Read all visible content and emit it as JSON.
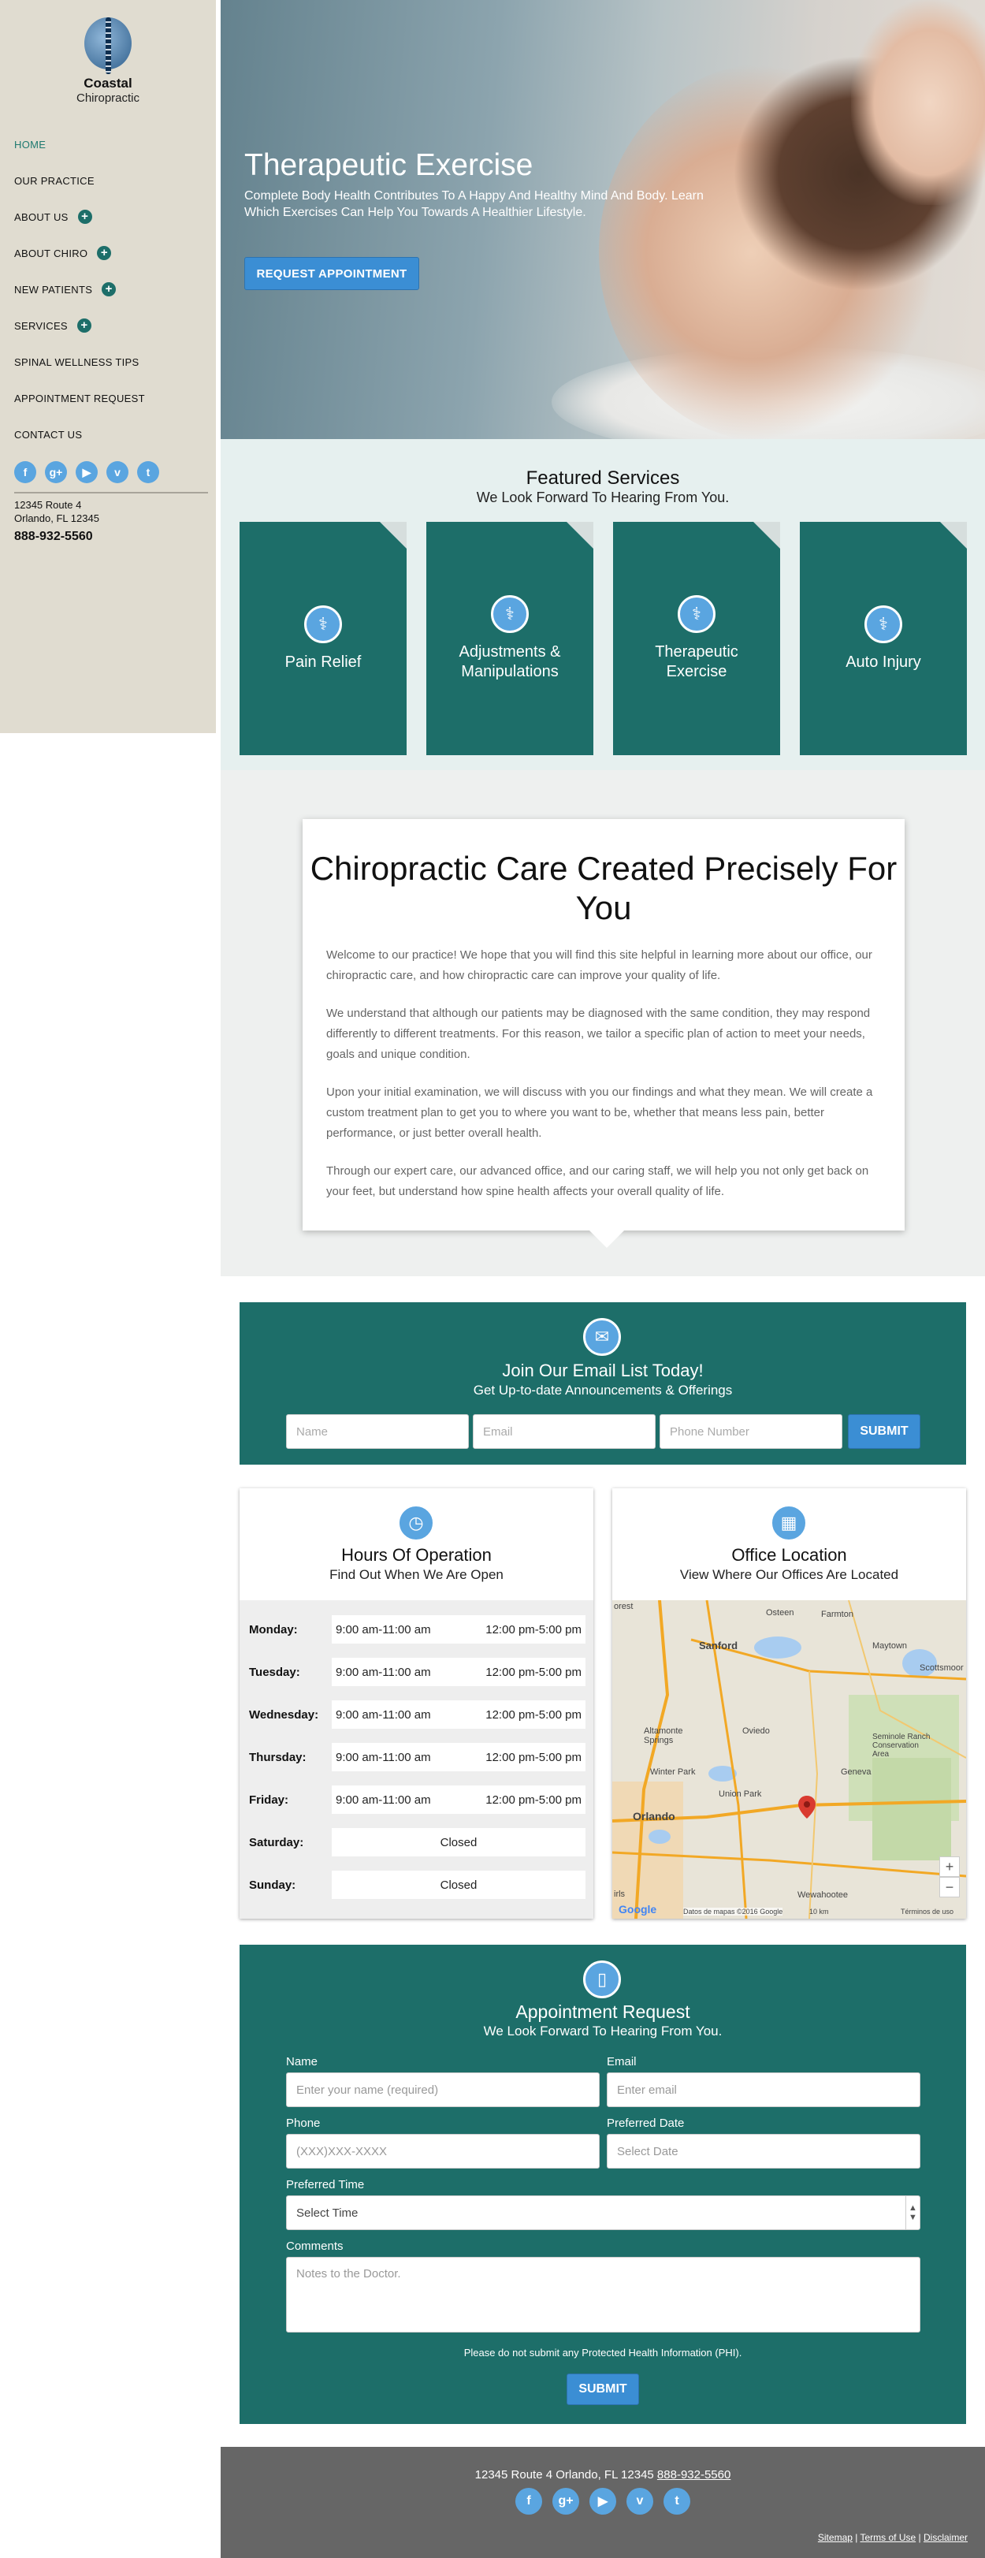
{
  "brand": {
    "name": "Coastal",
    "tagline": "Chiropractic"
  },
  "nav": [
    {
      "label": "HOME",
      "active": true,
      "expandable": false
    },
    {
      "label": "OUR PRACTICE",
      "expandable": false
    },
    {
      "label": "ABOUT US",
      "expandable": true
    },
    {
      "label": "ABOUT CHIRO",
      "expandable": true
    },
    {
      "label": "NEW PATIENTS",
      "expandable": true
    },
    {
      "label": "SERVICES",
      "expandable": true
    },
    {
      "label": "SPINAL WELLNESS TIPS",
      "expandable": false
    },
    {
      "label": "APPOINTMENT REQUEST",
      "expandable": false
    },
    {
      "label": "CONTACT US",
      "expandable": false
    }
  ],
  "socials": [
    "f",
    "g+",
    "yt",
    "v",
    "twitter"
  ],
  "sidebar_contact": {
    "address1": "12345 Route 4",
    "address2": "Orlando, FL 12345",
    "phone": "888-932-5560"
  },
  "hero": {
    "title": "Therapeutic Exercise",
    "text": "Complete Body Health Contributes To A Happy And Healthy Mind And Body. Learn Which Exercises Can Help You Towards A Healthier Lifestyle.",
    "button": "REQUEST APPOINTMENT"
  },
  "featured": {
    "title": "Featured Services",
    "subtitle": "We Look Forward To Hearing From You.",
    "cards": [
      {
        "label": "Pain Relief",
        "icon": "stethoscope-icon"
      },
      {
        "label": "Adjustments & Manipulations",
        "icon": "stethoscope-icon"
      },
      {
        "label": "Therapeutic Exercise",
        "icon": "stethoscope-icon"
      },
      {
        "label": "Auto Injury",
        "icon": "stethoscope-icon"
      }
    ]
  },
  "about": {
    "title": "Chiropractic Care Created Precisely For You",
    "paragraphs": [
      "Welcome to our practice! We hope that you will find this site helpful in learning more about our office, our chiropractic care, and how chiropractic care can improve your quality of life.",
      "We understand that although our patients may be diagnosed with the same condition, they may respond differently to different treatments. For this reason, we tailor a specific plan of action to meet your needs, goals and unique condition.",
      "Upon your initial examination, we will discuss with you our findings and what they mean. We will create a custom treatment plan to get you to where you want to be, whether that means less pain, better performance, or just better overall health.",
      "Through our expert care, our advanced office, and our caring staff, we will help you not only get back on your feet, but understand how spine health affects your overall quality of life."
    ]
  },
  "email_list": {
    "title": "Join Our Email List Today!",
    "subtitle": "Get Up-to-date Announcements & Offerings",
    "name_placeholder": "Name",
    "email_placeholder": "Email",
    "phone_placeholder": "Phone Number",
    "submit": "SUBMIT"
  },
  "hours": {
    "title": "Hours Of Operation",
    "subtitle": "Find Out When We Are Open",
    "rows": [
      {
        "day": "Monday:",
        "am": "9:00 am-11:00 am",
        "pm": "12:00 pm-5:00 pm"
      },
      {
        "day": "Tuesday:",
        "am": "9:00 am-11:00 am",
        "pm": "12:00 pm-5:00 pm"
      },
      {
        "day": "Wednesday:",
        "am": "9:00 am-11:00 am",
        "pm": "12:00 pm-5:00 pm"
      },
      {
        "day": "Thursday:",
        "am": "9:00 am-11:00 am",
        "pm": "12:00 pm-5:00 pm"
      },
      {
        "day": "Friday:",
        "am": "9:00 am-11:00 am",
        "pm": "12:00 pm-5:00 pm"
      },
      {
        "day": "Saturday:",
        "closed": "Closed"
      },
      {
        "day": "Sunday:",
        "closed": "Closed"
      }
    ]
  },
  "location": {
    "title": "Office Location",
    "subtitle": "View Where Our Offices Are Located",
    "map_labels": [
      "Osteen",
      "Farmton",
      "Sanford",
      "Maytown",
      "Altamonte Springs",
      "Oviedo",
      "Scottsmoor",
      "Winter Park",
      "Union Park",
      "Geneva",
      "Seminole Ranch Conservation Area",
      "Orlando",
      "Wewahootee",
      "Google",
      "Datos de mapas ©2016 Google",
      "10 km",
      "Términos de uso",
      "orest",
      "irls"
    ],
    "zoom_in": "+",
    "zoom_out": "−"
  },
  "appointment": {
    "title": "Appointment Request",
    "subtitle": "We Look Forward To Hearing From You.",
    "name_label": "Name",
    "name_placeholder": "Enter your name (required)",
    "email_label": "Email",
    "email_placeholder": "Enter email",
    "phone_label": "Phone",
    "phone_placeholder": "(XXX)XXX-XXXX",
    "date_label": "Preferred Date",
    "date_placeholder": "Select Date",
    "time_label": "Preferred Time",
    "time_value": "Select Time",
    "comments_label": "Comments",
    "comments_placeholder": "Notes to the Doctor.",
    "phi_note": "Please do not submit any Protected Health Information (PHI).",
    "submit": "SUBMIT"
  },
  "footer": {
    "address": "12345 Route 4 Orlando, FL 12345",
    "phone": "888-932-5560",
    "links": [
      "Sitemap",
      "Terms of Use",
      "Disclaimer"
    ]
  },
  "colors": {
    "teal": "#1d6e69",
    "accent_blue": "#3b8ed4",
    "sidebar_bg": "#e0dcd0",
    "footer_bg": "#666666"
  }
}
